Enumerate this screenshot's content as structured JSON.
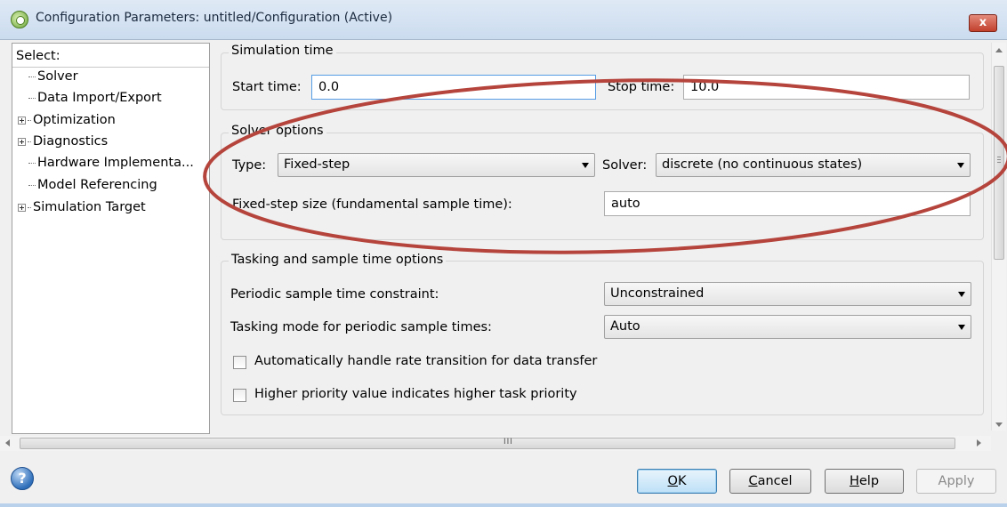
{
  "window": {
    "title": "Configuration Parameters: untitled/Configuration (Active)",
    "close_label": "x"
  },
  "tree": {
    "header": "Select:",
    "items": [
      {
        "label": "Solver",
        "expandable": false
      },
      {
        "label": "Data Import/Export",
        "expandable": false
      },
      {
        "label": "Optimization",
        "expandable": true
      },
      {
        "label": "Diagnostics",
        "expandable": true
      },
      {
        "label": "Hardware Implementa...",
        "expandable": false
      },
      {
        "label": "Model Referencing",
        "expandable": false
      },
      {
        "label": "Simulation Target",
        "expandable": true
      }
    ]
  },
  "simulation_time": {
    "title": "Simulation time",
    "start_label": "Start time:",
    "start_value": "0.0",
    "stop_label": "Stop time:",
    "stop_value": "10.0"
  },
  "solver_options": {
    "title": "Solver options",
    "type_label": "Type:",
    "type_value": "Fixed-step",
    "solver_label": "Solver:",
    "solver_value": "discrete (no continuous states)",
    "step_size_label": "Fixed-step size (fundamental sample time):",
    "step_size_value": "auto"
  },
  "tasking": {
    "title": "Tasking and sample time options",
    "periodic_label": "Periodic sample time constraint:",
    "periodic_value": "Unconstrained",
    "mode_label": "Tasking mode for periodic sample times:",
    "mode_value": "Auto",
    "rate_transition_label": "Automatically handle rate transition for data transfer",
    "rate_transition_checked": false,
    "priority_label": "Higher priority value indicates higher task priority",
    "priority_checked": false
  },
  "scrollbar": {
    "grip": "III"
  },
  "buttons": {
    "ok_mnemonic": "O",
    "ok_rest": "K",
    "cancel_mnemonic": "C",
    "cancel_rest": "ancel",
    "help_mnemonic": "H",
    "help_rest": "elp",
    "apply": "Apply"
  },
  "help_icon": {
    "glyph": "?"
  },
  "annotation": {
    "color": "#b5443c"
  },
  "colors": {
    "selection_border": "#569de5",
    "default_button": "#3c7fb1"
  }
}
